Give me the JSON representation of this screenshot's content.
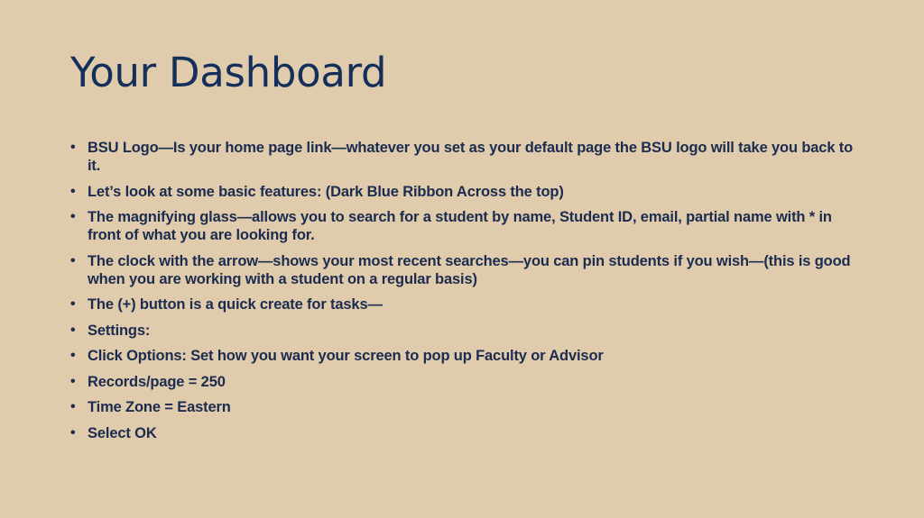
{
  "slide": {
    "title": "Your Dashboard",
    "bullet_glyph": "•",
    "bullets": [
      "BSU Logo—Is your home page link—whatever you set as your default page the BSU logo will take you back to it.",
      "Let’s look at some basic features: (Dark Blue Ribbon Across the top)",
      "The magnifying glass—allows you to search for a student by name,  Student ID,  email, partial name with * in front of what you are looking for.",
      "The clock with the arrow—shows your most recent searches—you can pin students if you wish—(this is good when you are working with a student on a regular basis)",
      "The (+) button is a quick create for tasks—",
      "Settings:",
      "Click Options:  Set how you want your screen to pop up Faculty or Advisor",
      "Records/page = 250",
      "Time Zone = Eastern",
      "Select OK"
    ]
  },
  "colors": {
    "background": "#e0cbad",
    "title": "#14305a",
    "text": "#1b2c4f"
  }
}
